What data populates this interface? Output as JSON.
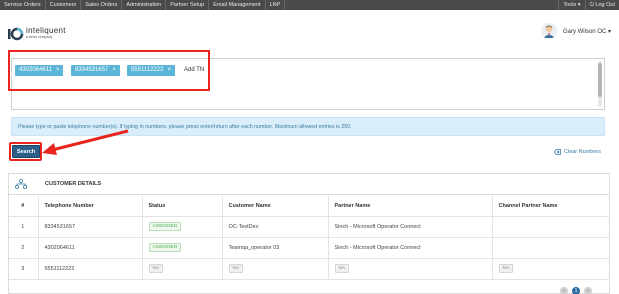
{
  "topnav": {
    "items": [
      "Service Orders",
      "Customers",
      "Sales Orders",
      "Administration",
      "Partner Setup",
      "Email Management",
      "LNP"
    ],
    "tools": "Tools ▾",
    "logout": "Log Out"
  },
  "header": {
    "logo_name": "inteliquent",
    "logo_sub": "a sinch company",
    "user_name": "Gary Wilson OC ▾"
  },
  "tn_input": {
    "chips": [
      "4302064611",
      "8334531657",
      "5551112222"
    ],
    "chip_remove_glyph": "×",
    "add_placeholder": "Add TN"
  },
  "info_message": "Please type or paste telephone number(s). If typing in numbers, please press enter/return after each number. Maximum allowed entries is 250.",
  "actions": {
    "search_label": "Search",
    "clear_label": "Clear Numbers"
  },
  "customer_details": {
    "title": "CUSTOMER DETAILS",
    "columns": [
      "#",
      "Telephone Number",
      "Status",
      "Customer Name",
      "Partner Name",
      "Channel Partner Name"
    ],
    "rows": [
      {
        "num": "1",
        "tn": "8334531657",
        "status": "ASSIGNED",
        "customer": "OC-TestDev",
        "partner": "Sinch - Microsoft Operator Connect",
        "channel": ""
      },
      {
        "num": "2",
        "tn": "4302064611",
        "status": "ASSIGNED",
        "customer": "Teamqa_operator 03",
        "partner": "Sinch - Microsoft Operator Connect",
        "channel": ""
      },
      {
        "num": "3",
        "tn": "5551112222",
        "status": "NA",
        "customer": "NA",
        "partner": "NA",
        "channel": "NA"
      }
    ]
  },
  "pagination": {
    "prev": "‹",
    "current": "1",
    "next": "›"
  },
  "colors": {
    "chip": "#5bb5d6",
    "search_button": "#2b5f8a",
    "annotation_red": "#e8261f",
    "info_bg": "#d9eef8"
  }
}
